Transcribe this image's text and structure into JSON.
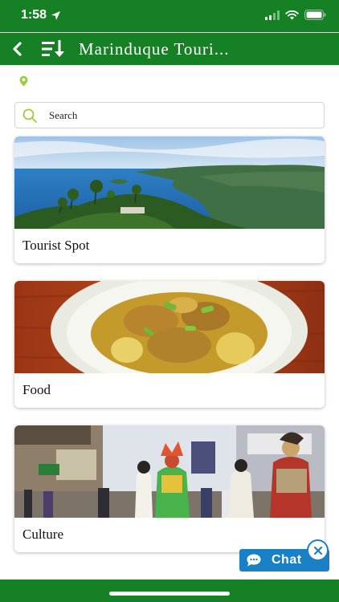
{
  "status_bar": {
    "time": "1:58",
    "location_arrow_icon": "location-arrow-icon",
    "signal_icon": "cellular-signal-icon",
    "wifi_icon": "wifi-icon",
    "battery_icon": "battery-icon"
  },
  "header": {
    "title": "Marinduque Touri...",
    "back_icon": "chevron-left-icon",
    "sort_icon": "sort-list-icon"
  },
  "location_icon": "map-pin-icon",
  "search": {
    "placeholder": "Search",
    "icon": "search-icon"
  },
  "cards": [
    {
      "label": "Tourist Spot",
      "image": "coastline-landscape-photo"
    },
    {
      "label": "Food",
      "image": "curry-dish-photo"
    },
    {
      "label": "Culture",
      "image": "moriones-festival-photo"
    }
  ],
  "chat": {
    "label": "Chat",
    "icon": "chat-bubble-icon",
    "close_icon": "close-icon"
  },
  "colors": {
    "brand_green": "#168124",
    "chat_blue": "#1a80c5",
    "search_icon_green": "#9ccd3a"
  }
}
